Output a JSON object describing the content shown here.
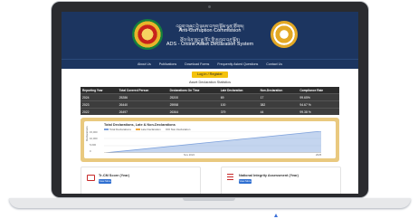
{
  "colors": {
    "header_bg": "#1c3560",
    "login_btn": "#f4c20d",
    "chart_frame": "#e9c97f",
    "table_header_bg": "#2c2c2c",
    "table_row_bg": "#3d3d3d",
    "accent_red": "#c62828",
    "view_btn": "#2f6fd1"
  },
  "header": {
    "title_dz_1": "འབྲུག་གཞུང་བྱེ་ཉམས་བཀག་སྡོམ་ལྷན་ཚོགས།",
    "title_en_1": "Anti-Corruption Commission",
    "title_dz_2": "ཐོག་ལེན་ཁྱད་རྒྱུ་ནོར་གྱི་རྒྱ་ཁྱབ་བརྡ་སྟོན།",
    "title_en_2": "ADS - Online Asset Declaration System",
    "left_emblem": "royal-emblem-icon",
    "right_emblem": "acc-logo-icon"
  },
  "nav": {
    "items": [
      "About Us",
      "Publications",
      "Download Forms",
      "Frequently Asked Questions",
      "Contact Us"
    ]
  },
  "login_label": "Log in / Register",
  "stats": {
    "title": "Asset Declaration Statistics",
    "columns": [
      "Reporting Year",
      "Total Covered Person",
      "Declarations On Time",
      "Late Declaration",
      "Non-Declaration",
      "Compliance Rate"
    ],
    "rows": [
      [
        "2024",
        "25286",
        "25200",
        "69",
        "17",
        "99.65%"
      ],
      [
        "2023",
        "26440",
        "25958",
        "100",
        "382",
        "94.67 %"
      ],
      [
        "2022",
        "26497",
        "26364",
        "379",
        "44",
        "99.38 %"
      ]
    ]
  },
  "chart_data": {
    "type": "area",
    "title": "Total Declarations, Late & Non-Declarations",
    "ylabel": "Declarations",
    "yticks": [
      "15,000",
      "10,000",
      "5,000",
      "0"
    ],
    "x_tick_labels": [
      "Nov 2024",
      "2025"
    ],
    "ylim": [
      0,
      15000
    ],
    "series": [
      {
        "name": "Total Declarations",
        "color": "#7da1dc",
        "x": [
          0,
          1
        ],
        "values": [
          0,
          15000
        ]
      },
      {
        "name": "Late Declaration",
        "color": "#f2a93b",
        "x": [
          0,
          1
        ],
        "values": [
          0,
          0
        ]
      },
      {
        "name": "Non-Declaration",
        "color": "#c7c7c7",
        "x": [
          0,
          1
        ],
        "values": [
          0,
          0
        ]
      }
    ],
    "grid": true,
    "legend": "top-left"
  },
  "cards": [
    {
      "title": "Tr-CM Score (Year)",
      "button": "View More",
      "icon": "book-icon"
    },
    {
      "title": "National Integrity Assessment (Year)",
      "button": "View More",
      "icon": "list-icon"
    }
  ]
}
